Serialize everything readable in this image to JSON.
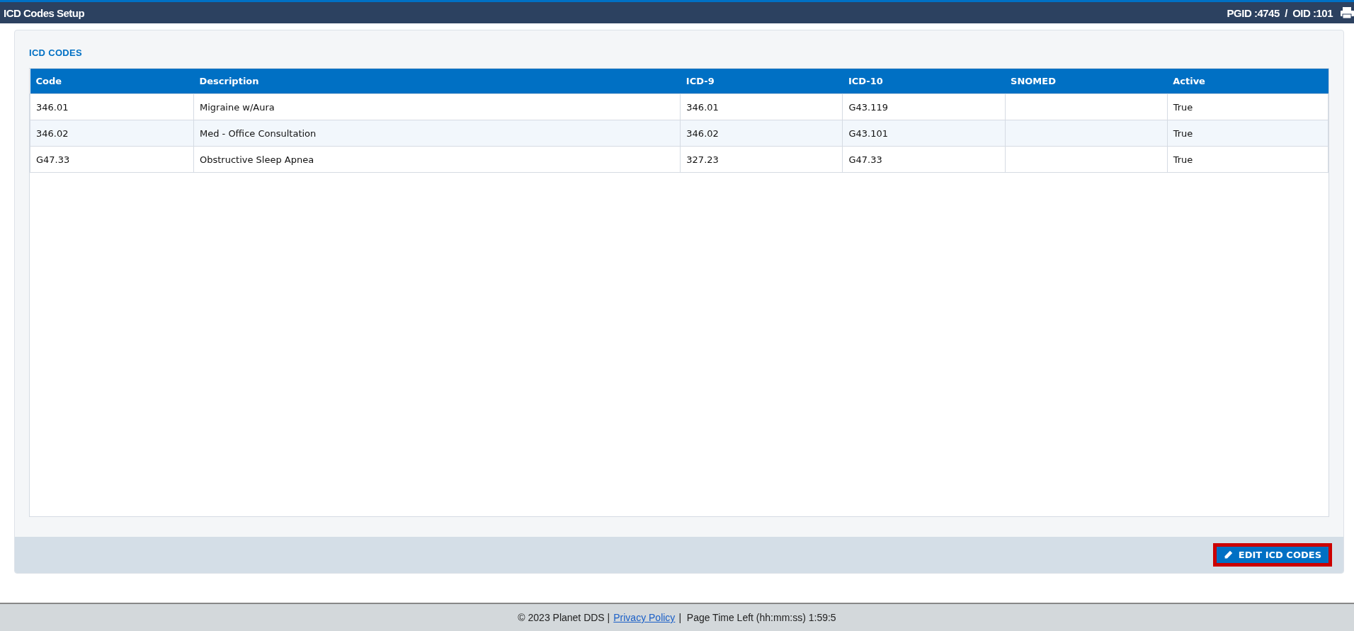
{
  "window": {
    "title": "ICD Codes Setup",
    "ids": "PGID :4745  /  OID :101"
  },
  "panel": {
    "title": "ICD CODES",
    "button": "EDIT ICD CODES"
  },
  "table": {
    "columns": [
      "Code",
      "Description",
      "ICD-9",
      "ICD-10",
      "SNOMED",
      "Active"
    ],
    "rows": [
      [
        "346.01",
        "Migraine w/Aura",
        "346.01",
        "G43.119",
        "",
        "True"
      ],
      [
        "346.02",
        "Med - Office Consultation",
        "346.02",
        "G43.101",
        "",
        "True"
      ],
      [
        "G47.33",
        "Obstructive Sleep Apnea",
        "327.23",
        "G47.33",
        "",
        "True"
      ]
    ]
  },
  "footer": {
    "copyright": "© 2023 Planet DDS |",
    "link": "Privacy Policy",
    "timer": "|  Page Time Left (hh:mm:ss) 1:59:5"
  }
}
